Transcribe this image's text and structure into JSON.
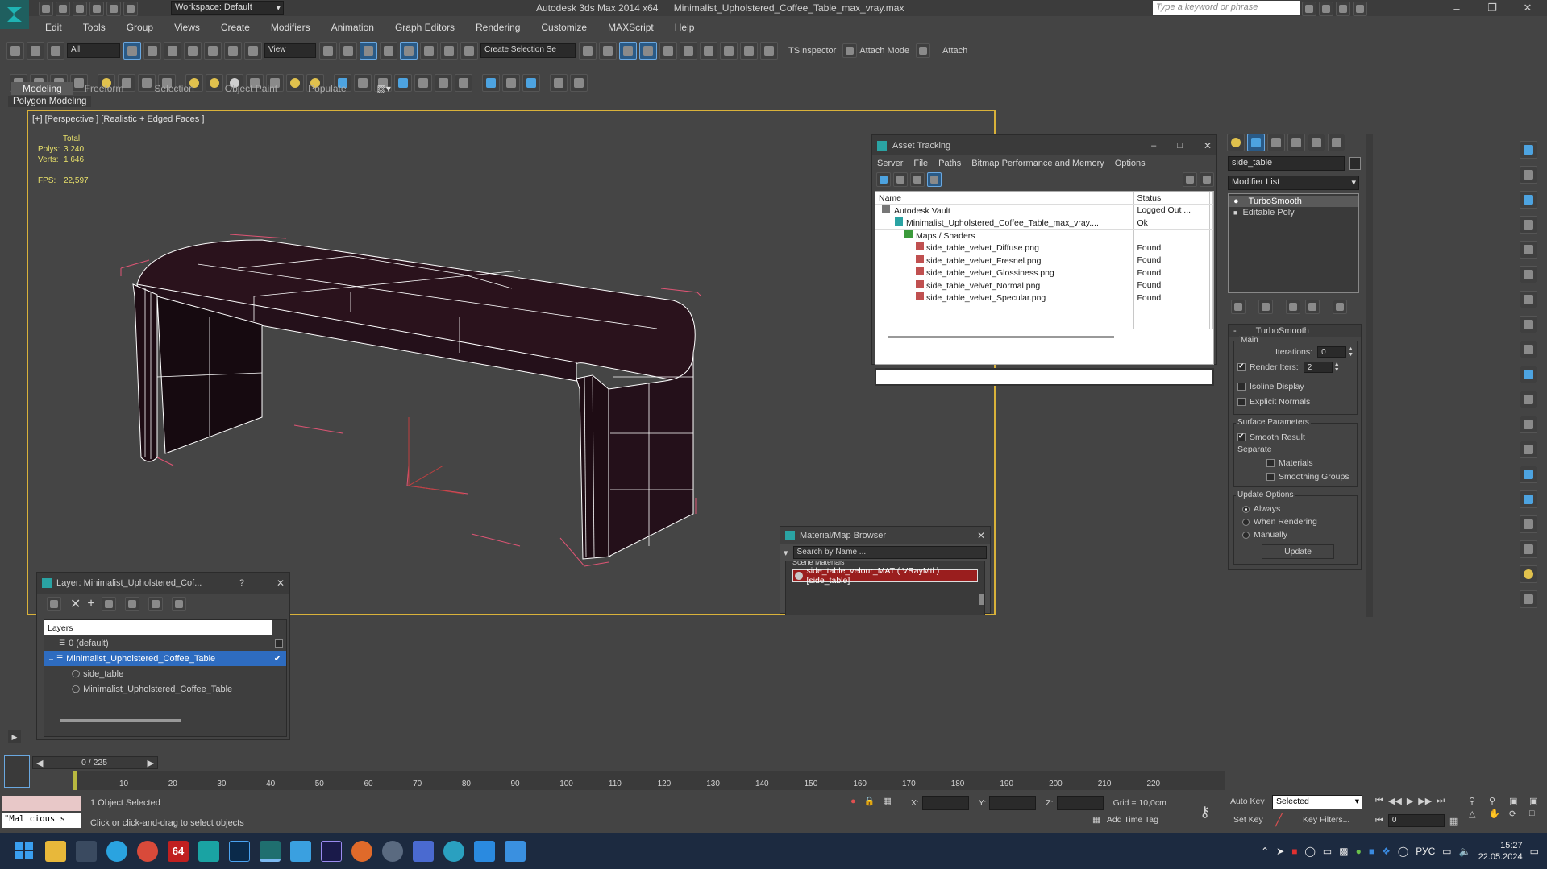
{
  "titlebar": {
    "workspace": "Workspace: Default",
    "app_title": "Autodesk 3ds Max  2014 x64",
    "file_title": "Minimalist_Upholstered_Coffee_Table_max_vray.max",
    "search_placeholder": "Type a keyword or phrase"
  },
  "menu": [
    "Edit",
    "Tools",
    "Group",
    "Views",
    "Create",
    "Modifiers",
    "Animation",
    "Graph Editors",
    "Rendering",
    "Customize",
    "MAXScript",
    "Help"
  ],
  "toolbar": {
    "selection_filter": "All",
    "ref_coord": "View",
    "named_sel": "Create Selection Se",
    "snap_num": "2.5",
    "tsinspector": "TSInspector",
    "attach_mode": "Attach Mode",
    "attach": "Attach"
  },
  "ribbon": {
    "tabs": [
      "Modeling",
      "Freeform",
      "Selection",
      "Object Paint",
      "Populate"
    ],
    "active_tab": "Modeling",
    "sub_label": "Polygon Modeling"
  },
  "viewport": {
    "label": "[+] [Perspective ] [Realistic + Edged Faces ]",
    "stats_header": "Total",
    "polys_label": "Polys:",
    "polys_value": "3 240",
    "verts_label": "Verts:",
    "verts_value": "1 646",
    "fps_label": "FPS:",
    "fps_value": "22,597",
    "wire_color": "#ffffff",
    "face_color": "#2a121c",
    "bbox_color": "#e05575"
  },
  "asset_tracking": {
    "title": "Asset Tracking",
    "menu": [
      "Server",
      "File",
      "Paths",
      "Bitmap Performance and Memory",
      "Options"
    ],
    "columns": [
      "Name",
      "Status",
      "P"
    ],
    "rows": [
      {
        "name": "Autodesk Vault",
        "status": "Logged Out ..."
      },
      {
        "name": "Minimalist_Upholstered_Coffee_Table_max_vray....",
        "status": "Ok"
      },
      {
        "name": "Maps / Shaders",
        "status": ""
      },
      {
        "name": "side_table_velvet_Diffuse.png",
        "status": "Found"
      },
      {
        "name": "side_table_velvet_Fresnel.png",
        "status": "Found"
      },
      {
        "name": "side_table_velvet_Glossiness.png",
        "status": "Found"
      },
      {
        "name": "side_table_velvet_Normal.png",
        "status": "Found"
      },
      {
        "name": "side_table_velvet_Specular.png",
        "status": "Found"
      }
    ]
  },
  "command_panel": {
    "object_name": "side_table",
    "modifier_list": "Modifier List",
    "stack": [
      "TurboSmooth",
      "Editable Poly"
    ],
    "rollout_title": "TurboSmooth",
    "main_group": "Main",
    "iterations_label": "Iterations:",
    "iterations_value": "0",
    "render_iters_label": "Render Iters:",
    "render_iters_value": "2",
    "isoline": "Isoline Display",
    "explicit_normals": "Explicit Normals",
    "surface_group": "Surface Parameters",
    "smooth_result": "Smooth Result",
    "separate": "Separate",
    "materials": "Materials",
    "smoothing_groups": "Smoothing Groups",
    "update_group": "Update Options",
    "always": "Always",
    "when_rendering": "When Rendering",
    "manually": "Manually",
    "update_btn": "Update"
  },
  "layer_dialog": {
    "title": "Layer: Minimalist_Upholstered_Cof...",
    "help": "?",
    "header": "Layers",
    "items": [
      "0 (default)",
      "Minimalist_Upholstered_Coffee_Table",
      "side_table",
      "Minimalist_Upholstered_Coffee_Table"
    ]
  },
  "material_browser": {
    "title": "Material/Map Browser",
    "search_placeholder": "Search by Name ...",
    "group": "Scene Materials",
    "material": "side_table_velour_MAT ( VRayMtl ) [side_table]"
  },
  "timeline": {
    "frame_counter": "0 / 225",
    "ticks": [
      "10",
      "20",
      "30",
      "40",
      "50",
      "60",
      "70",
      "80",
      "90",
      "100",
      "110",
      "120",
      "130",
      "140",
      "150",
      "160",
      "170",
      "180",
      "190",
      "200",
      "210",
      "220"
    ]
  },
  "status": {
    "maxscript": "\"Malicious s",
    "selected": "1 Object Selected",
    "prompt": "Click or click-and-drag to select objects",
    "x_label": "X:",
    "y_label": "Y:",
    "z_label": "Z:",
    "grid": "Grid = 10,0cm",
    "add_time_tag": "Add Time Tag",
    "auto_key": "Auto Key",
    "set_key": "Set Key",
    "key_mode": "Selected",
    "key_filters": "Key Filters...",
    "frame": "0"
  },
  "taskbar": {
    "badge_tg": "64",
    "lang": "РУС",
    "time": "15:27",
    "date": "22.05.2024"
  }
}
